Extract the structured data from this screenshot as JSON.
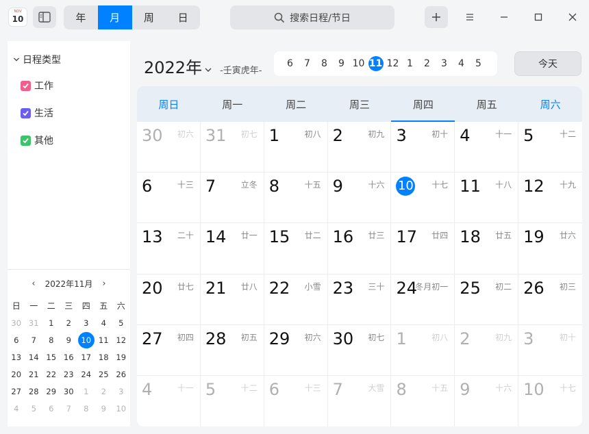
{
  "app": {
    "icon_month": "NOV",
    "icon_day": "10"
  },
  "view_switch": [
    {
      "label": "年",
      "active": false
    },
    {
      "label": "月",
      "active": true
    },
    {
      "label": "周",
      "active": false
    },
    {
      "label": "日",
      "active": false
    }
  ],
  "search": {
    "placeholder": "搜索日程/节日"
  },
  "sidebar": {
    "category_title": "日程类型",
    "categories": [
      {
        "label": "工作",
        "color": "#f25d8e"
      },
      {
        "label": "生活",
        "color": "#6b5cf2"
      },
      {
        "label": "其他",
        "color": "#3ec36b"
      }
    ],
    "mini_calendar": {
      "title": "2022年11月",
      "weekdays": [
        "日",
        "一",
        "二",
        "三",
        "四",
        "五",
        "六"
      ],
      "weeks": [
        [
          [
            "30",
            true
          ],
          [
            "31",
            true
          ],
          [
            "1",
            false
          ],
          [
            "2",
            false
          ],
          [
            "3",
            false
          ],
          [
            "4",
            false
          ],
          [
            "5",
            false
          ]
        ],
        [
          [
            "6",
            false
          ],
          [
            "7",
            false
          ],
          [
            "8",
            false
          ],
          [
            "9",
            false
          ],
          [
            "10",
            false,
            true
          ],
          [
            "11",
            false
          ],
          [
            "12",
            false
          ]
        ],
        [
          [
            "13",
            false
          ],
          [
            "14",
            false
          ],
          [
            "15",
            false
          ],
          [
            "16",
            false
          ],
          [
            "17",
            false
          ],
          [
            "18",
            false
          ],
          [
            "19",
            false
          ]
        ],
        [
          [
            "20",
            false
          ],
          [
            "21",
            false
          ],
          [
            "22",
            false
          ],
          [
            "23",
            false
          ],
          [
            "24",
            false
          ],
          [
            "25",
            false
          ],
          [
            "26",
            false
          ]
        ],
        [
          [
            "27",
            false
          ],
          [
            "28",
            false
          ],
          [
            "29",
            false
          ],
          [
            "30",
            false
          ],
          [
            "1",
            true
          ],
          [
            "2",
            true
          ],
          [
            "3",
            true
          ]
        ],
        [
          [
            "4",
            true
          ],
          [
            "5",
            true
          ],
          [
            "6",
            true
          ],
          [
            "7",
            true
          ],
          [
            "8",
            true
          ],
          [
            "9",
            true
          ],
          [
            "10",
            true
          ]
        ]
      ]
    }
  },
  "header": {
    "year": "2022年",
    "lunar_year": "-壬寅虎年-",
    "months": [
      "6",
      "7",
      "8",
      "9",
      "10",
      "11",
      "12",
      "1",
      "2",
      "3",
      "4",
      "5"
    ],
    "current_month": "11",
    "today_label": "今天"
  },
  "calendar": {
    "weekdays": [
      "周日",
      "周一",
      "周二",
      "周三",
      "周四",
      "周五",
      "周六"
    ],
    "weeks": [
      [
        [
          "30",
          "初六",
          true
        ],
        [
          "31",
          "初七",
          true
        ],
        [
          "1",
          "初八",
          false
        ],
        [
          "2",
          "初九",
          false
        ],
        [
          "3",
          "初十",
          false
        ],
        [
          "4",
          "十一",
          false
        ],
        [
          "5",
          "十二",
          false
        ]
      ],
      [
        [
          "6",
          "十三",
          false
        ],
        [
          "7",
          "立冬",
          false
        ],
        [
          "8",
          "十五",
          false
        ],
        [
          "9",
          "十六",
          false
        ],
        [
          "10",
          "十七",
          false,
          true
        ],
        [
          "11",
          "十八",
          false
        ],
        [
          "12",
          "十九",
          false
        ]
      ],
      [
        [
          "13",
          "二十",
          false
        ],
        [
          "14",
          "廿一",
          false
        ],
        [
          "15",
          "廿二",
          false
        ],
        [
          "16",
          "廿三",
          false
        ],
        [
          "17",
          "廿四",
          false
        ],
        [
          "18",
          "廿五",
          false
        ],
        [
          "19",
          "廿六",
          false
        ]
      ],
      [
        [
          "20",
          "廿七",
          false
        ],
        [
          "21",
          "廿八",
          false
        ],
        [
          "22",
          "小雪",
          false
        ],
        [
          "23",
          "三十",
          false
        ],
        [
          "24",
          "冬月初一",
          false
        ],
        [
          "25",
          "初二",
          false
        ],
        [
          "26",
          "初三",
          false
        ]
      ],
      [
        [
          "27",
          "初四",
          false
        ],
        [
          "28",
          "初五",
          false
        ],
        [
          "29",
          "初六",
          false
        ],
        [
          "30",
          "初七",
          false
        ],
        [
          "1",
          "初八",
          true
        ],
        [
          "2",
          "初九",
          true
        ],
        [
          "3",
          "初十",
          true
        ]
      ],
      [
        [
          "4",
          "十一",
          true
        ],
        [
          "5",
          "十二",
          true
        ],
        [
          "6",
          "十三",
          true
        ],
        [
          "7",
          "大雪",
          true
        ],
        [
          "8",
          "十五",
          true
        ],
        [
          "9",
          "十六",
          true
        ],
        [
          "10",
          "十七",
          true
        ]
      ]
    ]
  }
}
